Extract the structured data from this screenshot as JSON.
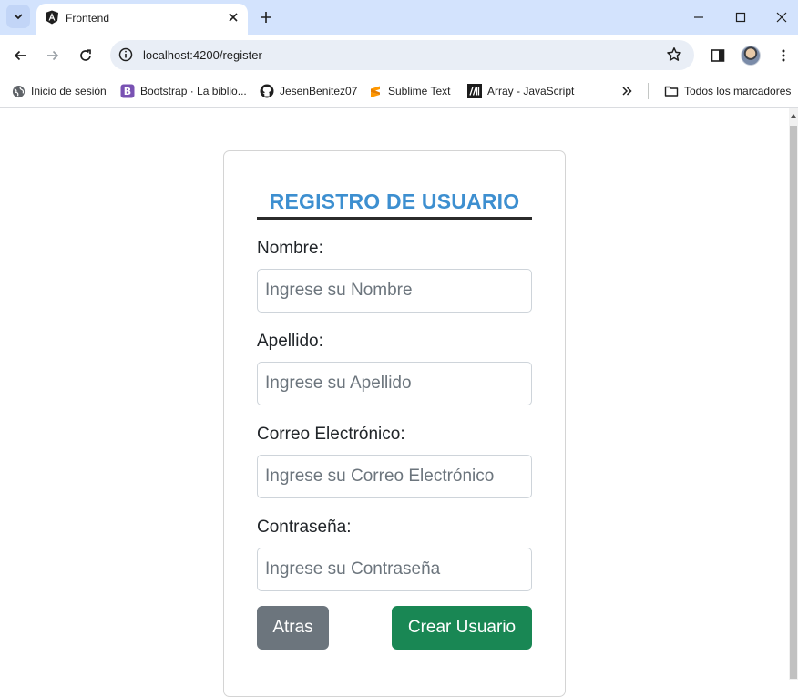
{
  "browser": {
    "tab": {
      "title": "Frontend"
    },
    "url": "localhost:4200/register",
    "bookmarks": [
      {
        "label": "Inicio de sesión",
        "icon": "globe-icon"
      },
      {
        "label": "Bootstrap · La biblio...",
        "icon": "bootstrap-icon"
      },
      {
        "label": "JesenBenitez07",
        "icon": "github-icon"
      },
      {
        "label": "Sublime Text",
        "icon": "sublime-icon"
      },
      {
        "label": "Array - JavaScript",
        "icon": "mdn-icon"
      }
    ],
    "all_bookmarks_label": "Todos los marcadores"
  },
  "form": {
    "title": "REGISTRO DE USUARIO",
    "fields": [
      {
        "label": "Nombre:",
        "placeholder": "Ingrese su Nombre",
        "value": ""
      },
      {
        "label": "Apellido:",
        "placeholder": "Ingrese su Apellido",
        "value": ""
      },
      {
        "label": "Correo Electrónico:",
        "placeholder": "Ingrese su Correo Electrónico",
        "value": ""
      },
      {
        "label": "Contraseña:",
        "placeholder": "Ingrese su Contraseña",
        "value": ""
      }
    ],
    "back_label": "Atras",
    "submit_label": "Crear Usuario"
  },
  "colors": {
    "title": "#3d8fd0",
    "back_button": "#6c757d",
    "submit_button": "#198754",
    "tabstrip": "#d3e3fd"
  }
}
